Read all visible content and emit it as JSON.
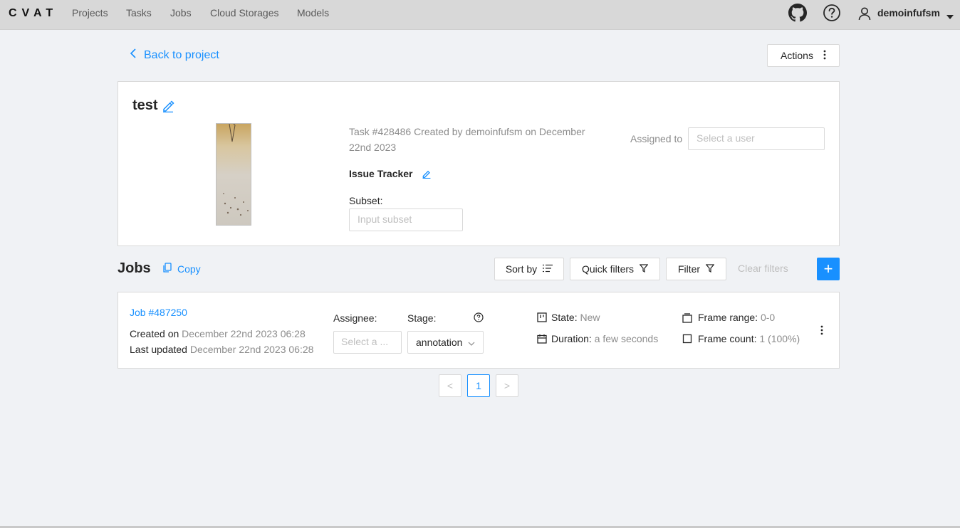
{
  "header": {
    "logo": "CVAT",
    "nav": [
      "Projects",
      "Tasks",
      "Jobs",
      "Cloud Storages",
      "Models"
    ],
    "icons": [
      "github-icon",
      "help-icon",
      "user-icon",
      "caret-down-icon"
    ],
    "username": "demoinfufsm"
  },
  "topbar": {
    "back_label": "Back to project",
    "actions_label": "Actions"
  },
  "task": {
    "title": "test",
    "info": "Task #428486 Created by demoinfufsm on December 22nd 2023",
    "issue_tracker_label": "Issue Tracker",
    "subset_label": "Subset:",
    "subset_placeholder": "Input subset",
    "assigned_label": "Assigned to",
    "assigned_placeholder": "Select a user"
  },
  "jobs_toolbar": {
    "title": "Jobs",
    "copy_label": "Copy",
    "sort_label": "Sort by",
    "quick_filters_label": "Quick filters",
    "filter_label": "Filter",
    "clear_filters_label": "Clear filters",
    "add_label": "+"
  },
  "job": {
    "link": "Job #487250",
    "created_label": "Created on",
    "created_value": "December 22nd 2023 06:28",
    "updated_label": "Last updated",
    "updated_value": "December 22nd 2023 06:28",
    "assignee_label": "Assignee:",
    "assignee_placeholder": "Select a ...",
    "stage_label": "Stage:",
    "stage_value": "annotation",
    "state_label": "State:",
    "state_value": "New",
    "duration_label": "Duration:",
    "duration_value": "a few seconds",
    "frame_range_label": "Frame range:",
    "frame_range_value": "0-0",
    "frame_count_label": "Frame count:",
    "frame_count_value": "1 (100%)"
  },
  "pagination": {
    "prev": "<",
    "current": "1",
    "next": ">"
  },
  "colors": {
    "accent": "#1890ff",
    "header_bg": "#d8d8d8",
    "page_bg": "#f0f2f5"
  }
}
